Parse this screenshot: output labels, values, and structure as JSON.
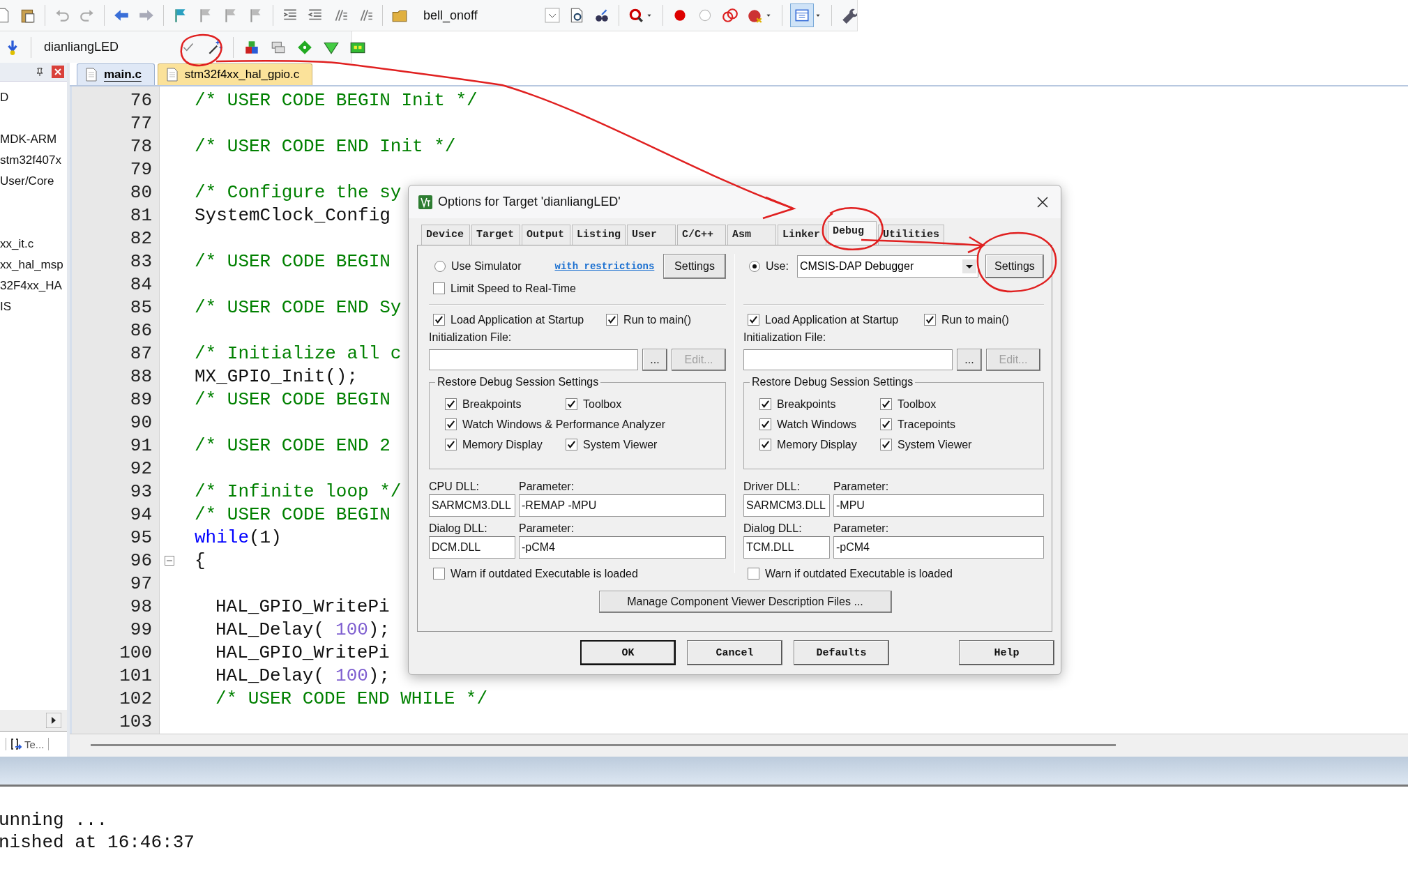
{
  "toolbar": {
    "project": "bell_onoff"
  },
  "build_toolbar": {
    "target": "dianliangLED"
  },
  "project_panel": {
    "items": [
      "D",
      "MDK-ARM",
      "stm32f407x",
      "User/Core",
      "xx_it.c",
      "xx_hal_msp",
      "32F4xx_HA",
      "IS"
    ],
    "tab_label": "Te..."
  },
  "editor": {
    "tabs": [
      {
        "label": "main.c",
        "selected": true
      },
      {
        "label": "stm32f4xx_hal_gpio.c",
        "selected": false
      }
    ],
    "lines": [
      {
        "number": "76",
        "indented": false,
        "fold": false,
        "segments": [
          {
            "text": "/* USER CODE BEGIN Init */",
            "kind": "comment"
          }
        ]
      },
      {
        "number": "77",
        "fold": false
      },
      {
        "number": "78",
        "indented": false,
        "fold": false,
        "segments": [
          {
            "text": "/* USER CODE END Init */",
            "kind": "comment"
          }
        ]
      },
      {
        "number": "79",
        "fold": false
      },
      {
        "number": "80",
        "indented": false,
        "fold": false,
        "segments": [
          {
            "text": "/* Configure the sy",
            "kind": "comment"
          }
        ]
      },
      {
        "number": "81",
        "indented": false,
        "fold": false,
        "segments": [
          {
            "text": "SystemClock_Config",
            "kind": "plain"
          }
        ]
      },
      {
        "number": "82",
        "fold": false
      },
      {
        "number": "83",
        "indented": false,
        "fold": false,
        "segments": [
          {
            "text": "/* USER CODE BEGIN",
            "kind": "comment"
          }
        ]
      },
      {
        "number": "84",
        "fold": false
      },
      {
        "number": "85",
        "indented": false,
        "fold": false,
        "segments": [
          {
            "text": "/* USER CODE END Sy",
            "kind": "comment"
          }
        ]
      },
      {
        "number": "86",
        "fold": false
      },
      {
        "number": "87",
        "indented": false,
        "fold": false,
        "segments": [
          {
            "text": "/* Initialize all c",
            "kind": "comment"
          }
        ]
      },
      {
        "number": "88",
        "indented": false,
        "fold": false,
        "segments": [
          {
            "text": "MX_GPIO_Init();",
            "kind": "plain"
          }
        ]
      },
      {
        "number": "89",
        "indented": false,
        "fold": false,
        "segments": [
          {
            "text": "/* USER CODE BEGIN",
            "kind": "comment"
          }
        ]
      },
      {
        "number": "90",
        "fold": false
      },
      {
        "number": "91",
        "indented": false,
        "fold": false,
        "segments": [
          {
            "text": "/* USER CODE END 2",
            "kind": "comment"
          }
        ]
      },
      {
        "number": "92",
        "fold": false
      },
      {
        "number": "93",
        "indented": false,
        "fold": false,
        "segments": [
          {
            "text": "/* Infinite loop */",
            "kind": "comment"
          }
        ]
      },
      {
        "number": "94",
        "indented": false,
        "fold": false,
        "segments": [
          {
            "text": "/* USER CODE BEGIN",
            "kind": "comment"
          }
        ]
      },
      {
        "number": "95",
        "indented": false,
        "fold": false,
        "segments": [
          {
            "text": "while",
            "kind": "keyword"
          },
          {
            "text": "(1)",
            "kind": "plain"
          }
        ]
      },
      {
        "number": "96",
        "indented": false,
        "fold": true,
        "segments": [
          {
            "text": "{",
            "kind": "plain"
          }
        ]
      },
      {
        "number": "97",
        "fold": false
      },
      {
        "number": "98",
        "indented": true,
        "fold": false,
        "segments": [
          {
            "text": "HAL_GPIO_WritePi",
            "kind": "plain"
          }
        ]
      },
      {
        "number": "99",
        "indented": true,
        "fold": false,
        "segments": [
          {
            "text": "HAL_Delay(",
            "kind": "plain"
          },
          {
            "text": "100",
            "kind": "number"
          },
          {
            "text": ");",
            "kind": "plain"
          }
        ]
      },
      {
        "number": "100",
        "indented": true,
        "fold": false,
        "segments": [
          {
            "text": "HAL_GPIO_WritePi",
            "kind": "plain"
          }
        ]
      },
      {
        "number": "101",
        "indented": true,
        "fold": false,
        "segments": [
          {
            "text": "HAL_Delay(",
            "kind": "plain"
          },
          {
            "text": "100",
            "kind": "number"
          },
          {
            "text": ");",
            "kind": "plain"
          }
        ]
      },
      {
        "number": "102",
        "indented": true,
        "fold": false,
        "segments": [
          {
            "text": "/* USER CODE END WHILE */",
            "kind": "comment"
          }
        ]
      },
      {
        "number": "103",
        "fold": false
      }
    ]
  },
  "output": {
    "lines": [
      "unning ...",
      "nished at 16:46:37"
    ]
  },
  "dialog": {
    "title": "Options for Target 'dianliangLED'",
    "tabs": [
      {
        "label": "Device",
        "selected": false
      },
      {
        "label": "Target",
        "selected": false
      },
      {
        "label": "Output",
        "selected": false
      },
      {
        "label": "Listing",
        "selected": false
      },
      {
        "label": "User",
        "selected": false
      },
      {
        "label": "C/C++",
        "selected": false
      },
      {
        "label": "Asm",
        "selected": false
      },
      {
        "label": "Linker",
        "selected": false
      },
      {
        "label": "Debug",
        "selected": true
      },
      {
        "label": "Utilities",
        "selected": false
      }
    ],
    "panes": [
      {
        "kind": "simulator",
        "radio": {
          "label": "Use Simulator",
          "selected": false
        },
        "link": "with restrictions",
        "settings": "Settings",
        "limit_speed": {
          "label": "Limit Speed to Real-Time",
          "checked": false
        },
        "load_app": {
          "label": "Load Application at Startup",
          "checked": true
        },
        "run_main": {
          "label": "Run to main()",
          "checked": true
        },
        "init_label": "Initialization File:",
        "browse": "...",
        "edit": {
          "label": "Edit...",
          "disabled": true
        },
        "group_title": "Restore Debug Session Settings",
        "checks": [
          {
            "label": "Breakpoints",
            "checked": true,
            "wide": false
          },
          {
            "label": "Toolbox",
            "checked": true,
            "wide": false
          },
          {
            "label": "Watch Windows & Performance Analyzer",
            "checked": true,
            "wide": true
          },
          {
            "label": "Memory Display",
            "checked": true,
            "wide": false
          },
          {
            "label": "System Viewer",
            "checked": true,
            "wide": false
          }
        ],
        "dll_label": "CPU DLL:",
        "dll": "SARMCM3.DLL",
        "param_label": "Parameter:",
        "param": "-REMAP -MPU",
        "dialog_dll_label": "Dialog DLL:",
        "dialog_dll": "DCM.DLL",
        "dialog_param_label": "Parameter:",
        "dialog_param": "-pCM4",
        "warn": {
          "label": "Warn if outdated Executable is loaded",
          "checked": false
        }
      },
      {
        "kind": "target",
        "radio": {
          "label": "Use:",
          "selected": true
        },
        "debugger": "CMSIS-DAP Debugger",
        "settings": "Settings",
        "load_app": {
          "label": "Load Application at Startup",
          "checked": true
        },
        "run_main": {
          "label": "Run to main()",
          "checked": true
        },
        "init_label": "Initialization File:",
        "browse": "...",
        "edit": {
          "label": "Edit...",
          "disabled": true
        },
        "group_title": "Restore Debug Session Settings",
        "checks": [
          {
            "label": "Breakpoints",
            "checked": true,
            "wide": false
          },
          {
            "label": "Toolbox",
            "checked": true,
            "wide": false
          },
          {
            "label": "Watch Windows",
            "checked": true,
            "wide": false
          },
          {
            "label": "Tracepoints",
            "checked": true,
            "wide": false
          },
          {
            "label": "Memory Display",
            "checked": true,
            "wide": false
          },
          {
            "label": "System Viewer",
            "checked": true,
            "wide": false
          }
        ],
        "dll_label": "Driver DLL:",
        "dll": "SARMCM3.DLL",
        "param_label": "Parameter:",
        "param": "-MPU",
        "dialog_dll_label": "Dialog DLL:",
        "dialog_dll": "TCM.DLL",
        "dialog_param_label": "Parameter:",
        "dialog_param": "-pCM4",
        "warn": {
          "label": "Warn if outdated Executable is loaded",
          "checked": false
        }
      }
    ],
    "manage": "Manage Component Viewer Description Files ...",
    "buttons": [
      {
        "label": "OK",
        "kind": "default"
      },
      {
        "label": "Cancel",
        "kind": "normal"
      },
      {
        "label": "Defaults",
        "kind": "normal"
      },
      {
        "label": "Help",
        "kind": "help"
      }
    ]
  }
}
